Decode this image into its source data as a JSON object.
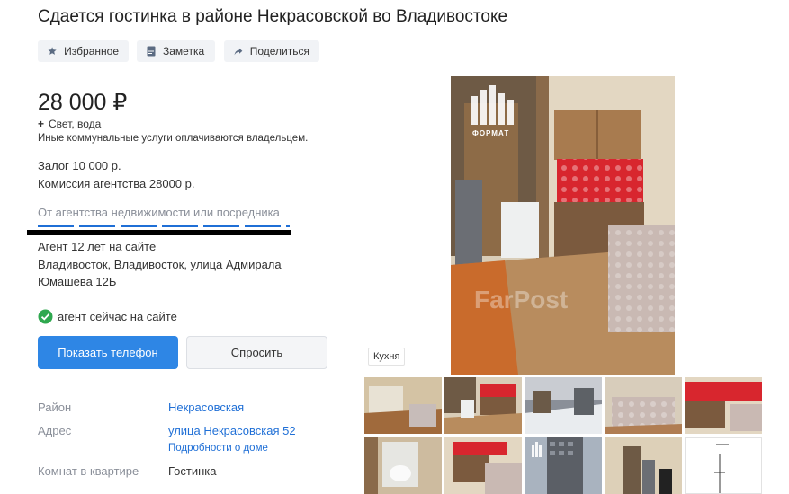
{
  "title": "Сдается гостинка в районе Некрасовской во Владивостоке",
  "toolbar": {
    "favorite_label": "Избранное",
    "note_label": "Заметка",
    "share_label": "Поделиться"
  },
  "price": {
    "amount": "28 000 ₽",
    "extra": "Свет, вода",
    "utilities_note": "Иные коммунальные услуги оплачиваются владельцем."
  },
  "terms": {
    "deposit": "Залог 10 000 р.",
    "commission": "Комиссия агентства 28000 р."
  },
  "agent": {
    "source": "От агентства недвижимости или посредника",
    "experience": "Агент 12 лет на сайте",
    "address_line1": "Владивосток, Владивосток, улица Адмирала",
    "address_line2": "Юмашева 12Б",
    "status": "агент сейчас на сайте"
  },
  "actions": {
    "show_phone": "Показать телефон",
    "ask": "Спросить"
  },
  "details": {
    "district_label": "Район",
    "district_value": "Некрасовская",
    "address_label": "Адрес",
    "address_value": "улица Некрасовская 52",
    "house_details_link": "Подробности о доме",
    "rooms_label": "Комнат в квартире",
    "rooms_value": "Гостинка"
  },
  "gallery": {
    "caption": "Кухня",
    "logo_text": "ФОРМАТ",
    "watermark": "FarPost"
  },
  "colors": {
    "primary_button": "#2e86e5",
    "link": "#1f6fd6",
    "online_green": "#2fa84f"
  }
}
